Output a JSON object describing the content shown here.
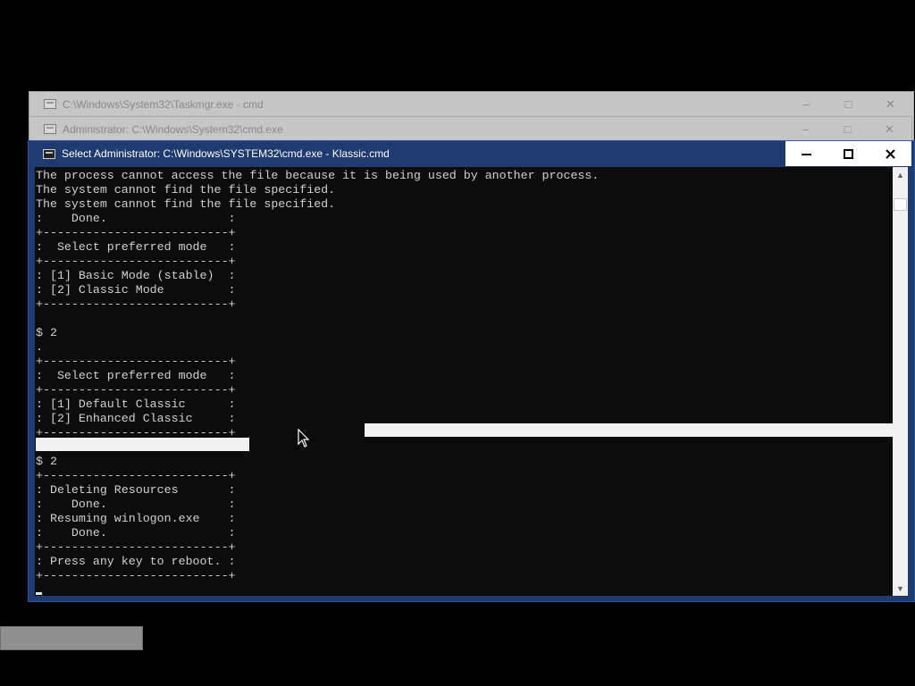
{
  "windows": {
    "taskmgr": {
      "title": "C:\\Windows\\System32\\Taskmgr.exe - cmd"
    },
    "admin_cmd": {
      "title": "Administrator: C:\\Windows\\System32\\cmd.exe"
    },
    "active": {
      "title": "Select Administrator: C:\\Windows\\SYSTEM32\\cmd.exe - Klassic.cmd",
      "controls": {
        "minimize": "–",
        "maximize": "□",
        "close": "✕"
      }
    }
  },
  "console": {
    "lines": [
      "The process cannot access the file because it is being used by another process.",
      "The system cannot find the file specified.",
      "The system cannot find the file specified.",
      ":    Done.                 :",
      "+--------------------------+",
      ":  Select preferred mode   :",
      "+--------------------------+",
      ": [1] Basic Mode (stable)  :",
      ": [2] Classic Mode         :",
      "+--------------------------+",
      "",
      "$ 2",
      ".",
      "+--------------------------+",
      ":  Select preferred mode   :",
      "+--------------------------+",
      ": [1] Default Classic      :",
      ": [2] Enhanced Classic     :",
      "+--------------------------+",
      "",
      "$ 2",
      "+--------------------------+",
      ": Deleting Resources       :",
      ":    Done.                 :",
      ": Resuming winlogon.exe    :",
      ":    Done.                 :",
      "+--------------------------+",
      ": Press any key to reboot. :",
      "+--------------------------+"
    ]
  },
  "scrollbar": {
    "up_arrow": "▲",
    "down_arrow": "▼"
  },
  "icons": {
    "cmd": "cmd-icon",
    "pointer": "mouse-pointer-icon"
  },
  "colors": {
    "active_titlebar": "#1e3a6e",
    "console_bg": "#0c0c0c",
    "console_text": "#d0d0d0",
    "desktop": "#000000"
  }
}
